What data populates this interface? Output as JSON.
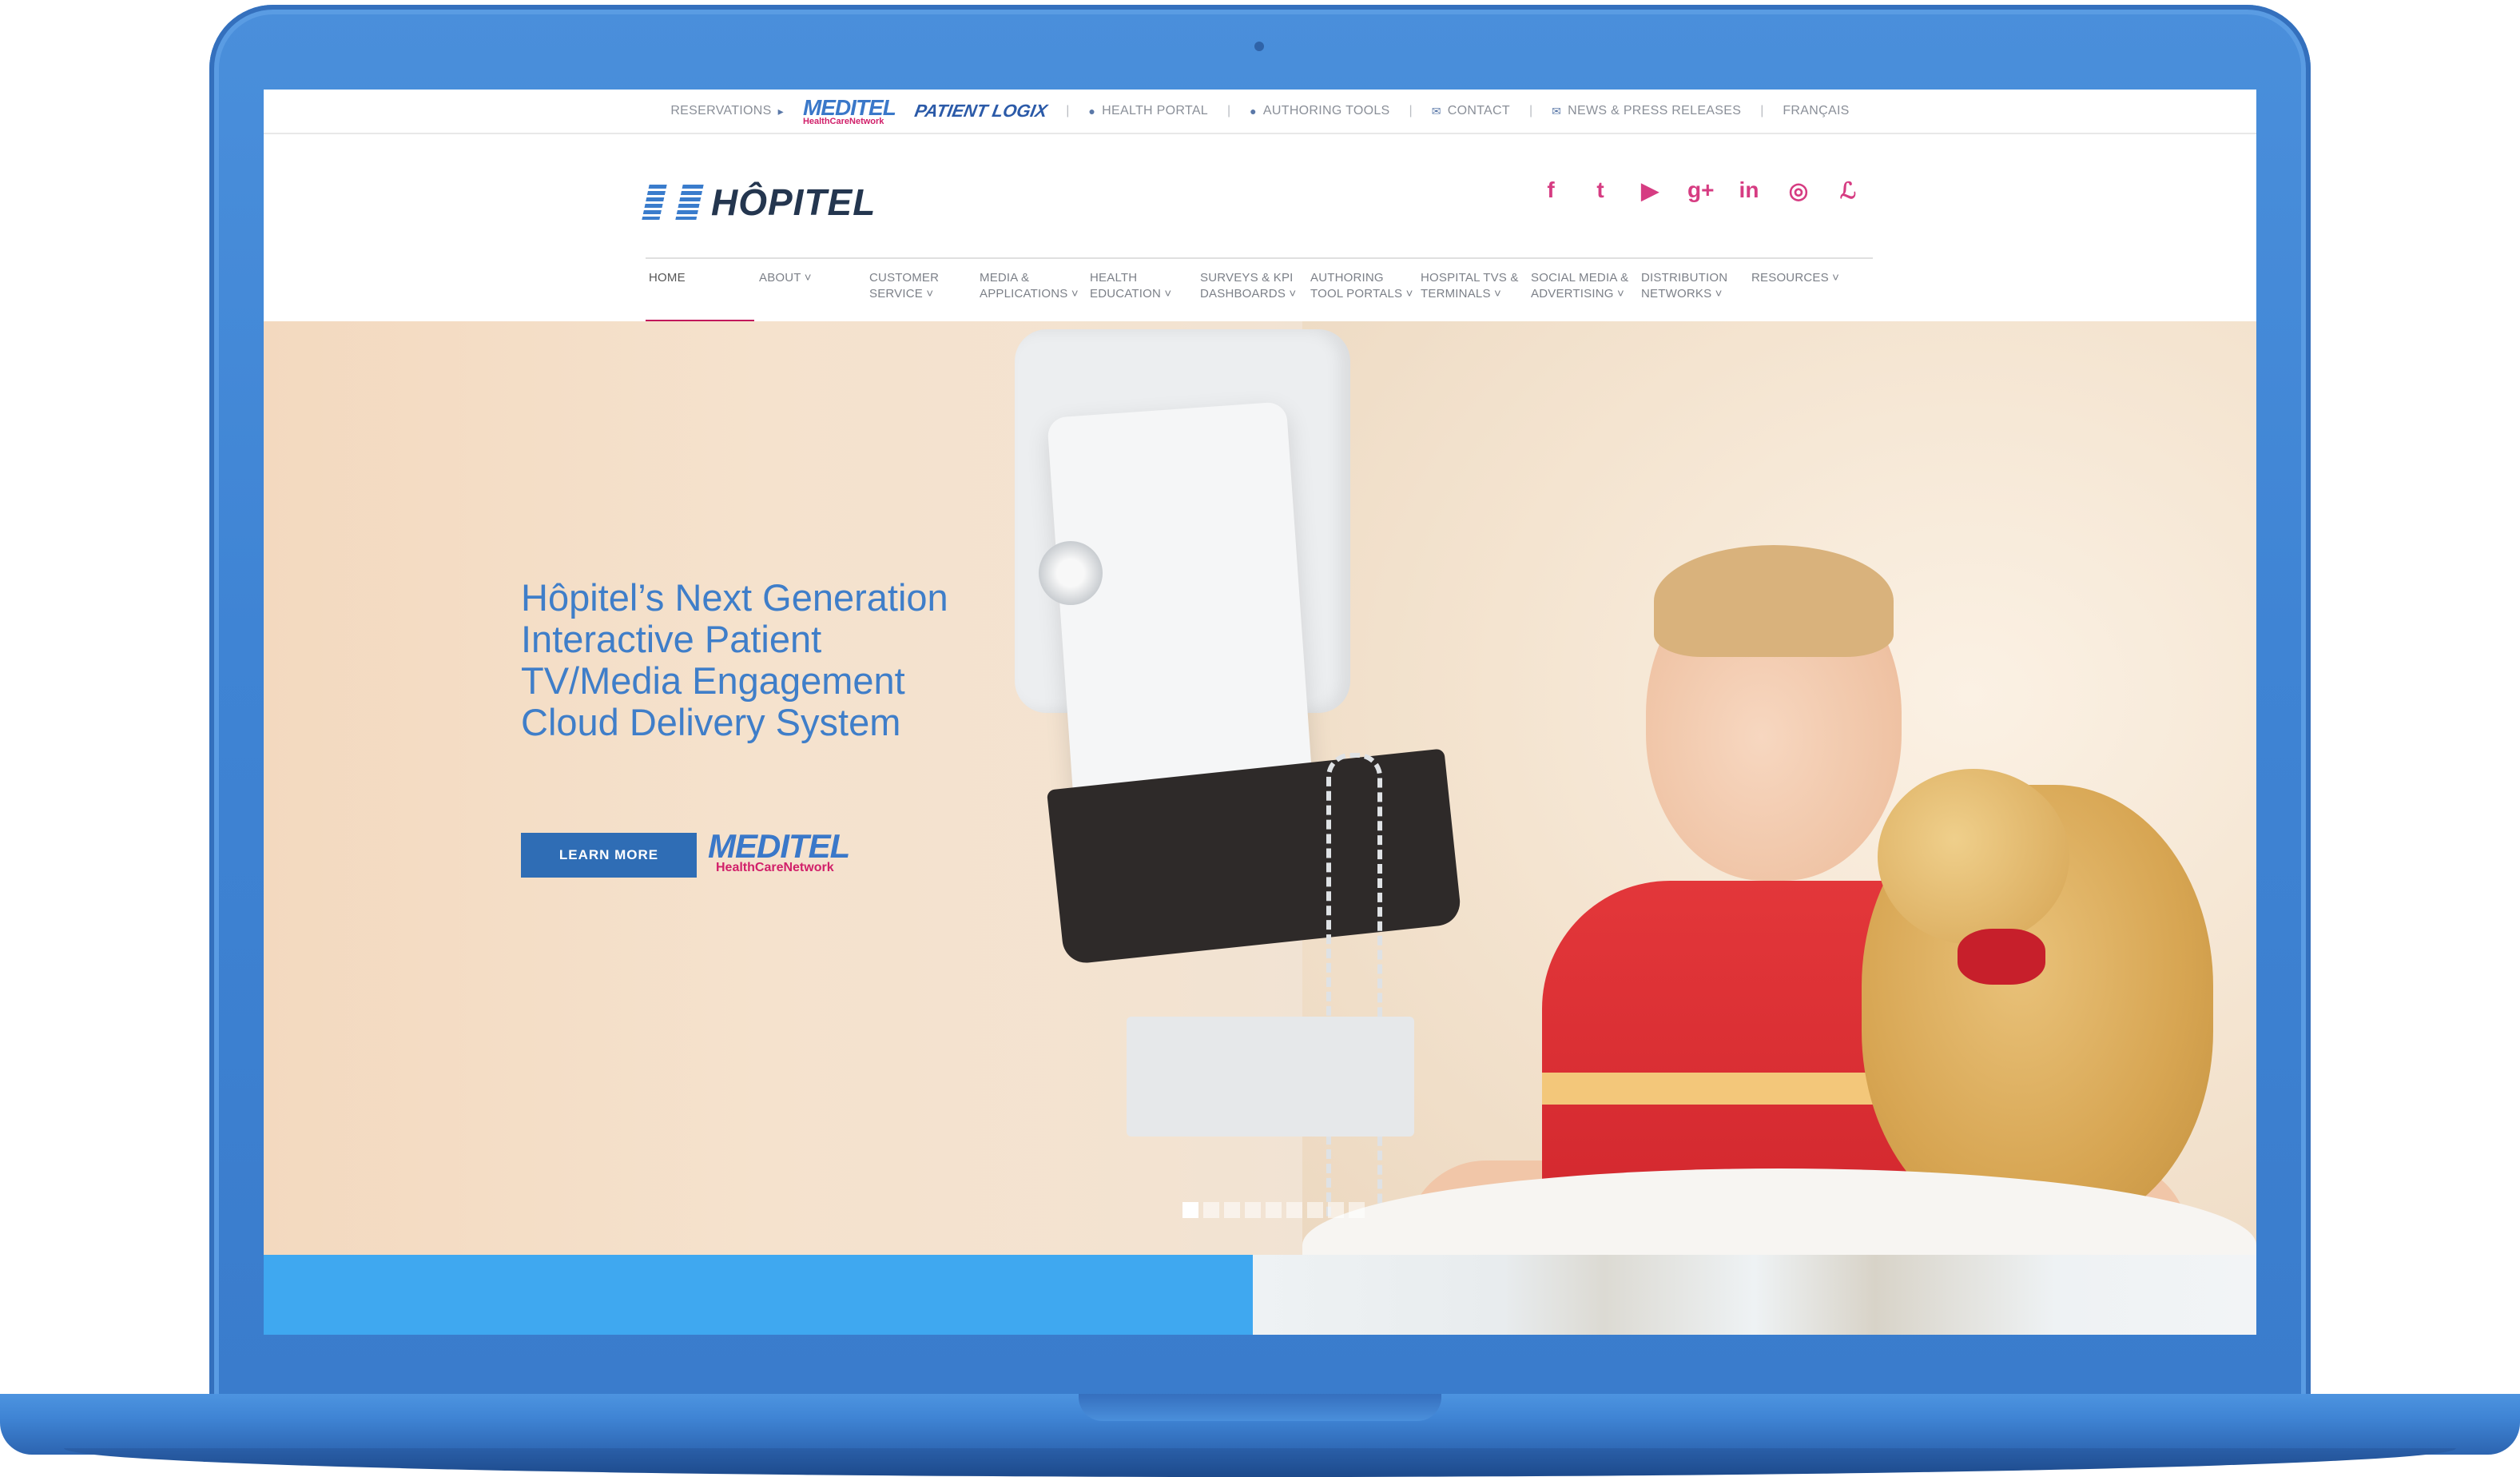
{
  "utility_bar": {
    "reservations_label": "RESERVATIONS",
    "meditel_name": "MEDITEL",
    "meditel_sub": "HealthCareNetwork",
    "patientlogix_name": "PATIENT LOGIX",
    "health_portal": "HEALTH PORTAL",
    "authoring_tools": "AUTHORING TOOLS",
    "contact": "CONTACT",
    "news": "NEWS & PRESS RELEASES",
    "language": "FRANÇAIS",
    "separator": "|"
  },
  "header": {
    "logo_text": "HÔPITEL",
    "social": [
      {
        "name": "facebook",
        "glyph": "f"
      },
      {
        "name": "twitter",
        "glyph": "t"
      },
      {
        "name": "youtube",
        "glyph": "▶"
      },
      {
        "name": "google-plus",
        "glyph": "g+"
      },
      {
        "name": "linkedin",
        "glyph": "in"
      },
      {
        "name": "instagram",
        "glyph": "◎"
      },
      {
        "name": "other",
        "glyph": "ℒ"
      }
    ]
  },
  "nav": {
    "items": [
      {
        "label": "HOME"
      },
      {
        "label": "ABOUT ˅"
      },
      {
        "label": "CUSTOMER SERVICE ˅"
      },
      {
        "label": "MEDIA & APPLICATIONS ˅"
      },
      {
        "label": "HEALTH EDUCATION ˅"
      },
      {
        "label": "SURVEYS & KPI DASHBOARDS ˅"
      },
      {
        "label": "AUTHORING TOOL PORTALS ˅"
      },
      {
        "label": "HOSPITAL TVS & TERMINALS ˅"
      },
      {
        "label": "SOCIAL MEDIA & ADVERTISING ˅"
      },
      {
        "label": "DISTRIBUTION NETWORKS ˅"
      },
      {
        "label": "RESOURCES ˅"
      }
    ]
  },
  "hero": {
    "headline": "Hôpitel’s Next Generation Interactive Patient TV/Media Engagement Cloud Delivery System",
    "button_label": "LEARN MORE",
    "meditel_name": "MEDITEL",
    "meditel_sub": "HealthCareNetwork",
    "slide_count": 9,
    "active_slide": 1
  },
  "colors": {
    "accent_pink": "#c2185b",
    "brand_blue": "#3f7ec9",
    "button_blue": "#2f6db5",
    "strip_blue": "#3fa8f0"
  }
}
